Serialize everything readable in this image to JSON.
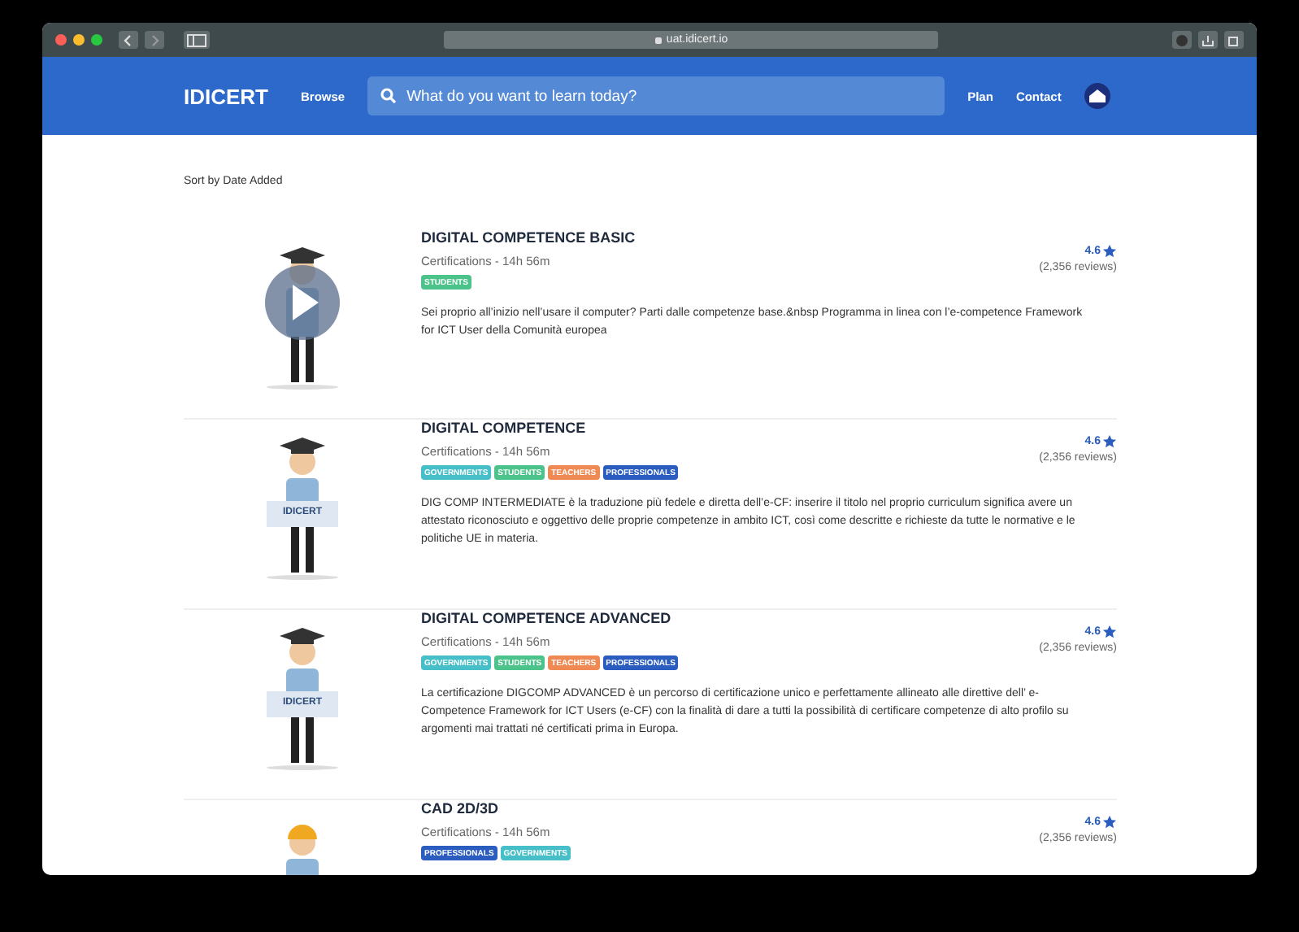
{
  "browser": {
    "url": "uat.idicert.io"
  },
  "header": {
    "logo": "IDICERT",
    "nav_left": [
      "Browse"
    ],
    "search": {
      "placeholder": "What do you want to learn today?"
    },
    "nav_right": [
      "Plan",
      "Contact"
    ]
  },
  "sort_label": "Sort by Date Added",
  "courses": [
    {
      "title": "DIGITAL COMPETENCE BASIC",
      "meta": "Certifications - 14h 56m",
      "tags": [
        {
          "label": "STUDENTS",
          "color": "#4cc38a"
        }
      ],
      "rating": "4.6",
      "reviews": "(2,356 reviews)",
      "description": "Sei proprio all’inizio nell’usare il computer? Parti dalle competenze base.&nbsp Programma in linea con l’e-competence Framework for ICT User della Comunità europea",
      "kind": "graduate",
      "video": true
    },
    {
      "title": "DIGITAL COMPETENCE",
      "meta": "Certifications - 14h 56m",
      "tags": [
        {
          "label": "GOVERNMENTS",
          "color": "#47bfc9"
        },
        {
          "label": "STUDENTS",
          "color": "#4cc38a"
        },
        {
          "label": "TEACHERS",
          "color": "#ef8a55"
        },
        {
          "label": "PROFESSIONALS",
          "color": "#2a5dbf"
        }
      ],
      "rating": "4.6",
      "reviews": "(2,356 reviews)",
      "description": "DIG COMP INTERMEDIATE è la traduzione più fedele e diretta dell’e-CF: inserire il titolo nel proprio curriculum significa avere un attestato riconosciuto e oggettivo delle proprie competenze in ambito ICT, così come descritte e richieste da tutte le normative e le politiche UE in materia.",
      "kind": "graduate",
      "sign": "IDICERT",
      "video": false
    },
    {
      "title": "DIGITAL COMPETENCE ADVANCED",
      "meta": "Certifications - 14h 56m",
      "tags": [
        {
          "label": "GOVERNMENTS",
          "color": "#47bfc9"
        },
        {
          "label": "STUDENTS",
          "color": "#4cc38a"
        },
        {
          "label": "TEACHERS",
          "color": "#ef8a55"
        },
        {
          "label": "PROFESSIONALS",
          "color": "#2a5dbf"
        }
      ],
      "rating": "4.6",
      "reviews": "(2,356 reviews)",
      "description": "La certificazione DIGCOMP ADVANCED è un percorso di certificazione unico e perfettamente allineato alle direttive dell’ e-Competence Framework for ICT Users (e-CF) con la finalità di dare a tutti la possibilità di certificare competenze di alto profilo su argomenti mai trattati né certificati prima in Europa.",
      "kind": "graduate",
      "sign": "IDICERT",
      "video": false
    },
    {
      "title": "CAD 2D/3D",
      "meta": "Certifications - 14h 56m",
      "tags": [
        {
          "label": "PROFESSIONALS",
          "color": "#2a5dbf"
        },
        {
          "label": "GOVERNMENTS",
          "color": "#47bfc9"
        }
      ],
      "rating": "4.6",
      "reviews": "(2,356 reviews)",
      "kind": "worker",
      "video": false
    }
  ]
}
